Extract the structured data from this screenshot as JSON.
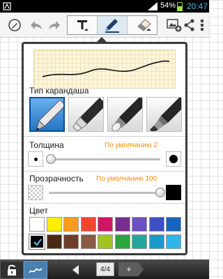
{
  "status_bar": {
    "battery_percent": "54%",
    "time": "20:47",
    "battery_color": "#9be24a",
    "time_color": "#4fb9e8"
  },
  "toolbar": {
    "icons": [
      "pen-mode-icon",
      "undo-icon",
      "redo-icon",
      "text-tool-icon",
      "pen-tool-icon",
      "eraser-tool-icon",
      "insert-image-icon",
      "share-icon",
      "more-icon"
    ]
  },
  "pen_settings": {
    "pen_type_label": "Тип карандаша",
    "pen_types": [
      "ballpoint",
      "highlighter",
      "marker",
      "brush"
    ],
    "selected_pen_index": 0,
    "thickness": {
      "label": "Толщина",
      "default_hint": "По умолчанию  2",
      "level": 0.02
    },
    "opacity": {
      "label": "Прозрачность",
      "default_hint": "По умолчанию  100",
      "level": 1.0
    },
    "color": {
      "label": "Цвет",
      "palette_row1": [
        "#ffffff",
        "#ffee00",
        "#ff9a1a",
        "#f5442e",
        "#d41464",
        "#7a2e8e",
        "#6c4fc2",
        "#3b4fc8",
        "#1565c0"
      ],
      "palette_row2": [
        "#000000",
        "#4a2b12",
        "#6e3d2a",
        "#8a5a44",
        "#a3c41e",
        "#2aa63c",
        "#22a89a",
        "#1b9acb",
        "#2eb6ea"
      ],
      "selected_color": "#000000"
    }
  },
  "bottom_bar": {
    "page_indicator": "4/4",
    "add_page_label": "+"
  }
}
